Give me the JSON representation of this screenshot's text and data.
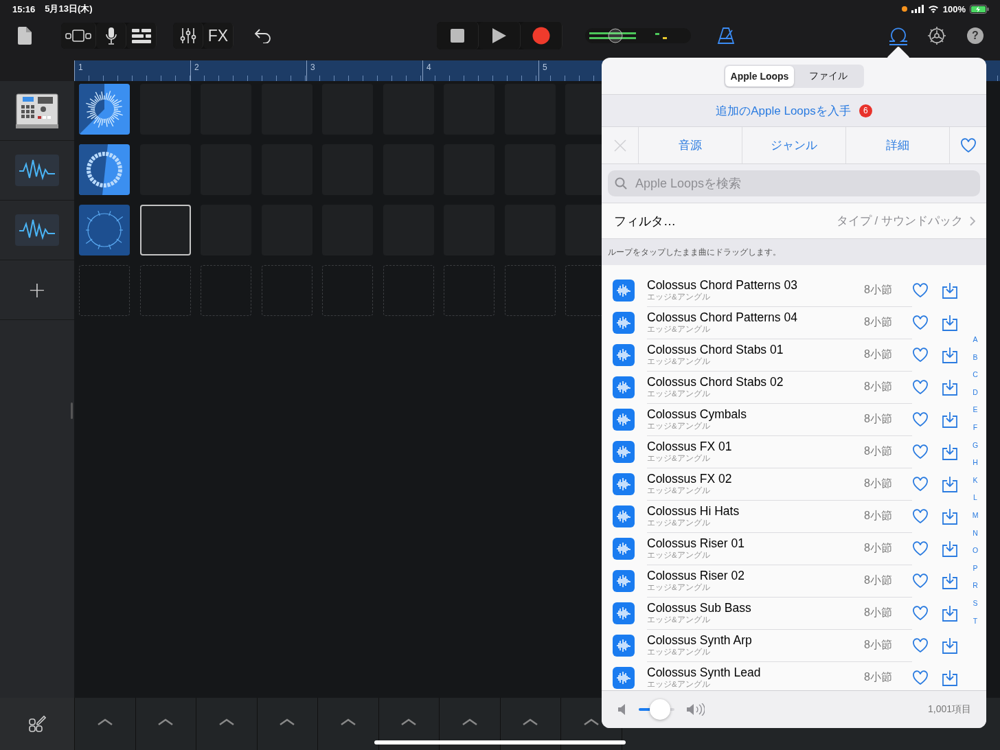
{
  "status_bar": {
    "time": "15:16",
    "date": "5月13日(木)",
    "battery": "100%"
  },
  "toolbar": {
    "fx": "FX",
    "help": "?"
  },
  "ruler": [
    "1",
    "2",
    "3",
    "4",
    "5"
  ],
  "tracks": [
    {
      "kind": "drum-machine"
    },
    {
      "kind": "audio"
    },
    {
      "kind": "audio"
    }
  ],
  "add_track": "+",
  "grid": {
    "rows": [
      {
        "cells": [
          {
            "kind": "burst",
            "playing": true,
            "selected": false
          },
          {
            "kind": "empty",
            "selected": false
          },
          {
            "kind": "empty",
            "selected": false
          },
          {
            "kind": "empty",
            "selected": false
          },
          {
            "kind": "empty",
            "selected": false
          },
          {
            "kind": "empty",
            "selected": false
          },
          {
            "kind": "empty",
            "selected": false
          },
          {
            "kind": "empty",
            "selected": false
          },
          {
            "kind": "empty",
            "selected": false
          }
        ]
      },
      {
        "cells": [
          {
            "kind": "ring",
            "playing": true,
            "selected": false
          },
          {
            "kind": "empty",
            "selected": false
          },
          {
            "kind": "empty",
            "selected": false
          },
          {
            "kind": "empty",
            "selected": false
          },
          {
            "kind": "empty",
            "selected": false
          },
          {
            "kind": "empty",
            "selected": false
          },
          {
            "kind": "empty",
            "selected": false
          },
          {
            "kind": "empty",
            "selected": false
          },
          {
            "kind": "empty",
            "selected": false
          }
        ]
      },
      {
        "cells": [
          {
            "kind": "ticks",
            "playing": false,
            "selected": false
          },
          {
            "kind": "empty",
            "selected": true
          },
          {
            "kind": "empty",
            "selected": false
          },
          {
            "kind": "empty",
            "selected": false
          },
          {
            "kind": "empty",
            "selected": false
          },
          {
            "kind": "empty",
            "selected": false
          },
          {
            "kind": "empty",
            "selected": false
          },
          {
            "kind": "empty",
            "selected": false
          },
          {
            "kind": "empty",
            "selected": false
          }
        ]
      },
      {
        "cells": [
          {
            "kind": "slot",
            "selected": false
          },
          {
            "kind": "slot",
            "selected": false
          },
          {
            "kind": "slot",
            "selected": false
          },
          {
            "kind": "slot",
            "selected": false
          },
          {
            "kind": "slot",
            "selected": false
          },
          {
            "kind": "slot",
            "selected": false
          },
          {
            "kind": "slot",
            "selected": false
          },
          {
            "kind": "slot",
            "selected": false
          },
          {
            "kind": "slot",
            "selected": false
          }
        ]
      }
    ]
  },
  "loop_browser": {
    "segments": [
      {
        "label": "Apple Loops",
        "selected": true
      },
      {
        "label": "ファイル",
        "selected": false
      }
    ],
    "get_more": {
      "text": "追加のApple Loopsを入手",
      "badge": "6"
    },
    "clear_disabled": true,
    "browse_tabs": [
      "音源",
      "ジャンル",
      "詳細"
    ],
    "search": {
      "placeholder": "Apple Loopsを検索"
    },
    "filter": {
      "label": "フィルタ…",
      "value": "タイプ / サウンドパック"
    },
    "hint": "ループをタップしたまま曲にドラッグします。",
    "loops": [
      {
        "name": "Colossus Chord Patterns 03",
        "pack": "エッジ&アングル",
        "length": "8小節",
        "favorite": false
      },
      {
        "name": "Colossus Chord Patterns 04",
        "pack": "エッジ&アングル",
        "length": "8小節",
        "favorite": false
      },
      {
        "name": "Colossus Chord Stabs 01",
        "pack": "エッジ&アングル",
        "length": "8小節",
        "favorite": false
      },
      {
        "name": "Colossus Chord Stabs 02",
        "pack": "エッジ&アングル",
        "length": "8小節",
        "favorite": false
      },
      {
        "name": "Colossus Cymbals",
        "pack": "エッジ&アングル",
        "length": "8小節",
        "favorite": false
      },
      {
        "name": "Colossus FX 01",
        "pack": "エッジ&アングル",
        "length": "8小節",
        "favorite": false
      },
      {
        "name": "Colossus FX 02",
        "pack": "エッジ&アングル",
        "length": "8小節",
        "favorite": false
      },
      {
        "name": "Colossus Hi Hats",
        "pack": "エッジ&アングル",
        "length": "8小節",
        "favorite": false
      },
      {
        "name": "Colossus Riser 01",
        "pack": "エッジ&アングル",
        "length": "8小節",
        "favorite": false
      },
      {
        "name": "Colossus Riser 02",
        "pack": "エッジ&アングル",
        "length": "8小節",
        "favorite": false
      },
      {
        "name": "Colossus Sub Bass",
        "pack": "エッジ&アングル",
        "length": "8小節",
        "favorite": false
      },
      {
        "name": "Colossus Synth Arp",
        "pack": "エッジ&アングル",
        "length": "8小節",
        "favorite": false
      },
      {
        "name": "Colossus Synth Lead",
        "pack": "エッジ&アングル",
        "length": "8小節",
        "favorite": false
      }
    ],
    "index": [
      "A",
      "B",
      "C",
      "D",
      "E",
      "F",
      "G",
      "H",
      "K",
      "L",
      "M",
      "N",
      "O",
      "P",
      "R",
      "S",
      "T"
    ],
    "volume": {
      "level": 0.6
    },
    "count": "1,001項目"
  }
}
